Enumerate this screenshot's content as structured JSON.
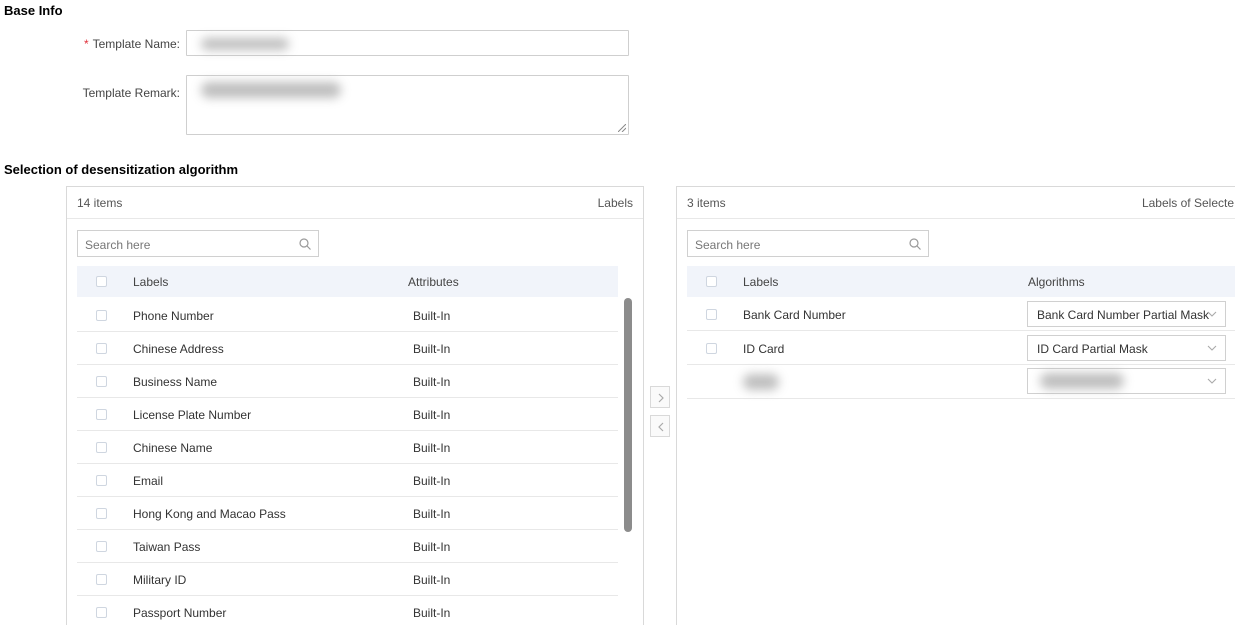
{
  "base_info": {
    "title": "Base Info",
    "template_name_label": "Template Name:",
    "template_remark_label": "Template Remark:"
  },
  "algo_section": {
    "title": "Selection of desensitization algorithm"
  },
  "left_panel": {
    "count": "14 items",
    "title": "Labels",
    "search_placeholder": "Search here",
    "columns": [
      "Labels",
      "Attributes"
    ],
    "rows": [
      {
        "label": "Phone Number",
        "attribute": "Built-In"
      },
      {
        "label": "Chinese Address",
        "attribute": "Built-In"
      },
      {
        "label": "Business Name",
        "attribute": "Built-In"
      },
      {
        "label": "License Plate Number",
        "attribute": "Built-In"
      },
      {
        "label": "Chinese Name",
        "attribute": "Built-In"
      },
      {
        "label": "Email",
        "attribute": "Built-In"
      },
      {
        "label": "Hong Kong and Macao Pass",
        "attribute": "Built-In"
      },
      {
        "label": "Taiwan Pass",
        "attribute": "Built-In"
      },
      {
        "label": "Military ID",
        "attribute": "Built-In"
      },
      {
        "label": "Passport Number",
        "attribute": "Built-In"
      }
    ]
  },
  "right_panel": {
    "count": "3 items",
    "title": "Labels of Selecte",
    "search_placeholder": "Search here",
    "columns": [
      "Labels",
      "Algorithms"
    ],
    "rows": [
      {
        "label": "Bank Card Number",
        "algorithm": "Bank Card Number Partial Mask"
      },
      {
        "label": "ID Card",
        "algorithm": "ID Card Partial Mask"
      },
      {
        "label": "",
        "algorithm": ""
      }
    ]
  },
  "icons": {
    "search": "search-icon",
    "transfer_right": "chevron-right-icon",
    "transfer_left": "chevron-left-icon",
    "dropdown": "chevron-down-icon"
  },
  "colors": {
    "required": "#e0303a",
    "table_header_bg": "#f1f4fa",
    "scrollbar": "#8c8c8c"
  }
}
